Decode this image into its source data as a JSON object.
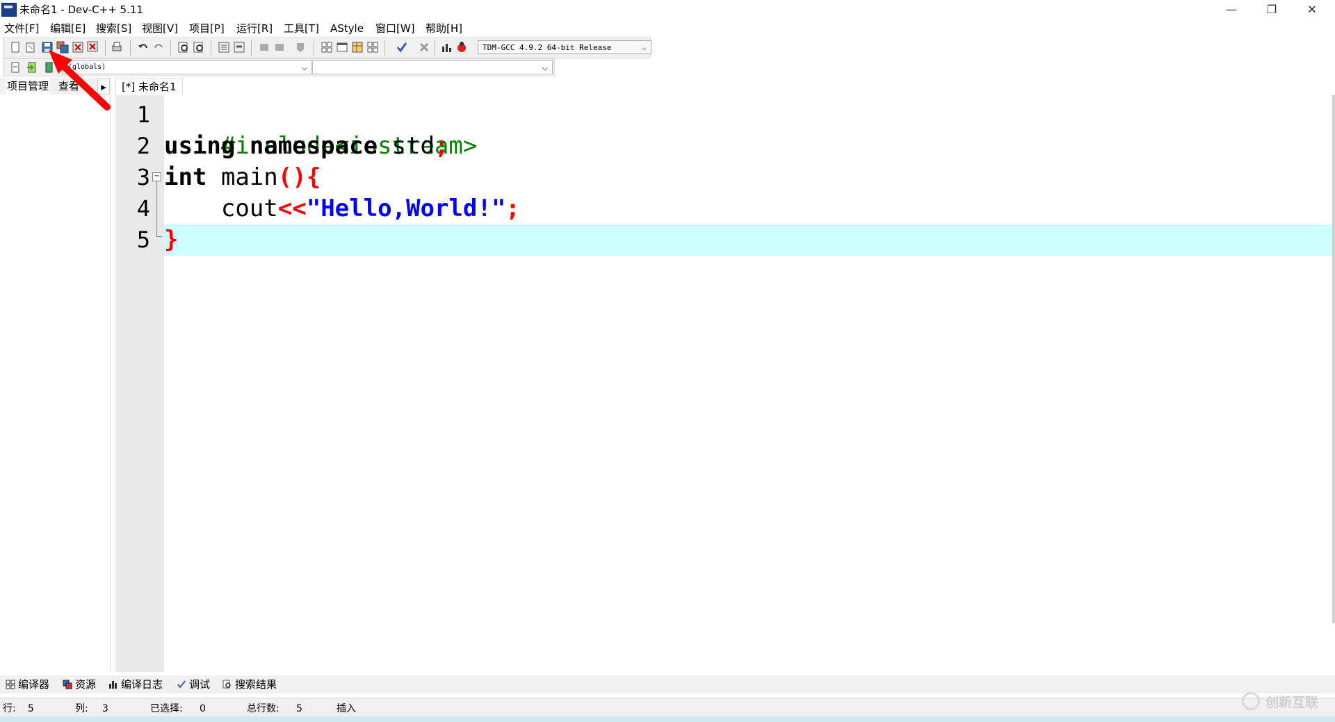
{
  "window": {
    "title": "未命名1 - Dev-C++ 5.11",
    "controls": [
      "—",
      "❐",
      "✕"
    ]
  },
  "menu": [
    "文件[F]",
    "编辑[E]",
    "搜索[S]",
    "视图[V]",
    "项目[P]",
    "运行[R]",
    "工具[T]",
    "AStyle",
    "窗口[W]",
    "帮助[H]"
  ],
  "toolbar": {
    "compiler": "TDM-GCC 4.9.2 64-bit Release",
    "scope": "(globals)",
    "member": ""
  },
  "left_panel": {
    "tabs": [
      "项目管理",
      "查看"
    ],
    "arrow": "▸"
  },
  "editor": {
    "tab_label": "[*] 未命名1",
    "lines": [
      {
        "num": "1"
      },
      {
        "num": "2"
      },
      {
        "num": "3"
      },
      {
        "num": "4"
      },
      {
        "num": "5"
      }
    ],
    "code": {
      "l1": "#include<iostream>",
      "l2_kw": "using namespace",
      "l2_rest": " std",
      "l2_semi": ";",
      "l3_kw": "int",
      "l3_rest": " main",
      "l3_ops": "(){",
      "l4_indent": "    cout",
      "l4_op": "<<",
      "l4_str": "\"Hello,World!\"",
      "l4_semi": ";",
      "l5": "}"
    },
    "highlight_color": "#ccffff"
  },
  "bottom_tabs": [
    "编译器",
    "资源",
    "编译日志",
    "调试",
    "搜索结果"
  ],
  "status": {
    "row_label": "行:",
    "row_value": "5",
    "col_label": "列:",
    "col_value": "3",
    "sel_label": "已选择:",
    "sel_value": "0",
    "total_label": "总行数:",
    "total_value": "5",
    "mode": "插入"
  },
  "watermark": "创新互联",
  "colors": {
    "keyword": "#000000",
    "preprocessor": "#008000",
    "operator": "#ff0000",
    "string": "#0000ff",
    "annotation_arrow": "#ff0000"
  }
}
